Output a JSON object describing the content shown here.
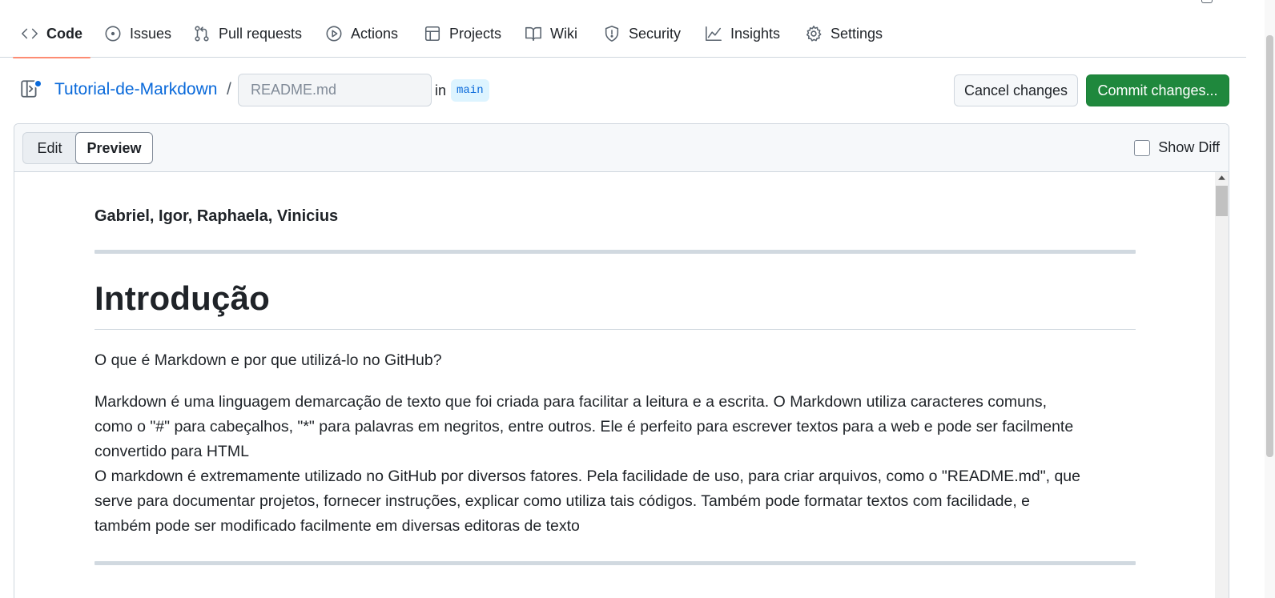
{
  "nav": {
    "items": [
      {
        "label": "Code",
        "icon": "code-icon",
        "active": true
      },
      {
        "label": "Issues",
        "icon": "issue-icon"
      },
      {
        "label": "Pull requests",
        "icon": "pull-request-icon"
      },
      {
        "label": "Actions",
        "icon": "play-icon"
      },
      {
        "label": "Projects",
        "icon": "table-icon"
      },
      {
        "label": "Wiki",
        "icon": "book-icon"
      },
      {
        "label": "Security",
        "icon": "shield-icon"
      },
      {
        "label": "Insights",
        "icon": "graph-icon"
      },
      {
        "label": "Settings",
        "icon": "gear-icon"
      }
    ]
  },
  "header": {
    "repo_name": "Tutorial-de-Markdown",
    "separator": "/",
    "filename_placeholder": "README.md",
    "in_label": "in",
    "branch": "main",
    "cancel_label": "Cancel changes",
    "commit_label": "Commit changes..."
  },
  "editor": {
    "tab_edit": "Edit",
    "tab_preview": "Preview",
    "active_tab": "Preview",
    "show_diff_label": "Show Diff",
    "show_diff_checked": false
  },
  "preview": {
    "authors": "Gabriel, Igor, Raphaela, Vinicius",
    "heading": "Introdução",
    "question": "O que é Markdown e por que utilizá-lo no GitHub?",
    "paragraph_line1": "Markdown é uma linguagem demarcação de texto que foi criada para facilitar a leitura e a escrita. O Markdown utiliza caracteres comuns,",
    "paragraph_line2": "como o \"#\" para cabeçalhos, \"*\" para palavras em negritos, entre outros. Ele é perfeito para escrever textos para a web e pode ser facilmente",
    "paragraph_line3": "convertido para HTML",
    "paragraph_line4": "O markdown é extremamente utilizado no GitHub por diversos fatores. Pela facilidade de uso, para criar arquivos, como o \"README.md\", que",
    "paragraph_line5": "serve para documentar projetos, fornecer instruções, explicar como utiliza tais códigos. Também pode formatar textos com facilidade, e",
    "paragraph_line6": "também pode ser modificado facilmente em diversas editoras de texto"
  },
  "colors": {
    "link": "#0969da",
    "commit_button": "#1f883d",
    "active_tab_underline": "#fd8c73",
    "branch_badge_bg": "#ddf4ff"
  }
}
